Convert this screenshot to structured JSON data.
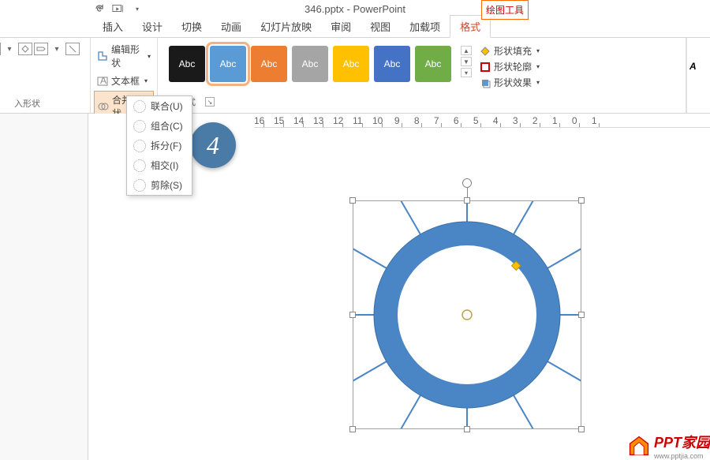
{
  "title": "346.pptx - PowerPoint",
  "drawing_tools_label": "绘图工具",
  "tabs": {
    "insert": "插入",
    "design": "设计",
    "transitions": "切换",
    "animations": "动画",
    "slideshow": "幻灯片放映",
    "review": "审阅",
    "view": "视图",
    "addins": "加载项",
    "format": "格式"
  },
  "shape_tools": {
    "edit_shape": "编辑形状",
    "text_box": "文本框",
    "merge_shapes": "合并形状"
  },
  "merge_menu": {
    "union": "联合(U)",
    "combine": "组合(C)",
    "fragment": "拆分(F)",
    "intersect": "相交(I)",
    "subtract": "剪除(S)"
  },
  "insert_shapes_label": "入形状",
  "shape_styles_label": "形状样式",
  "style_swatch_label": "Abc",
  "swatch_colors": [
    "#1a1a1a",
    "#5b9bd5",
    "#ed7d31",
    "#a5a5a5",
    "#ffc000",
    "#4472c4",
    "#70ad47"
  ],
  "style_options": {
    "fill": "形状填充",
    "outline": "形状轮廓",
    "effects": "形状效果"
  },
  "step_number": "4",
  "ruler_numbers": [
    "16",
    "15",
    "14",
    "13",
    "12",
    "11",
    "10",
    "9",
    "8",
    "7",
    "6",
    "5",
    "4",
    "3",
    "2",
    "1",
    "0",
    "1"
  ],
  "watermark": {
    "main": "PPT家园",
    "sub": "www.pptjia.com"
  },
  "shape_color": "#4a86c5"
}
